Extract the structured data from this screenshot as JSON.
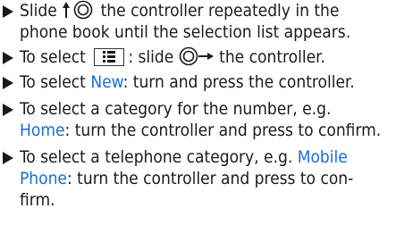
{
  "steps": [
    {
      "lines": [
        {
          "pre": "Slide ",
          "post": " the controller repeatedly in the"
        },
        {
          "text": "phone book until the selection list appears."
        }
      ]
    },
    {
      "lines": [
        {
          "pre": "To select ",
          "mid": ": slide ",
          "post": " the controller."
        }
      ]
    },
    {
      "lines": [
        {
          "pre": "To select ",
          "hl": "New",
          "post": ": turn and press the controller."
        }
      ]
    },
    {
      "lines": [
        {
          "text": "To select a category for the number, e.g."
        },
        {
          "hl": "Home",
          "post": ": turn the controller and press to confirm."
        }
      ]
    },
    {
      "lines": [
        {
          "pre": "To select a telephone category, e.g. ",
          "hl": "Mobile"
        },
        {
          "hl": "Phone",
          "post": ": turn the controller and press to con-"
        },
        {
          "text": "firm."
        }
      ]
    }
  ],
  "icons": {
    "bullet": "right-triangle-icon",
    "controller_up": "controller-slide-up-icon",
    "controller_right": "controller-slide-right-icon",
    "menu": "menu-list-icon"
  },
  "colors": {
    "highlight": "#1a6fd0",
    "text": "#1a1a1a"
  }
}
